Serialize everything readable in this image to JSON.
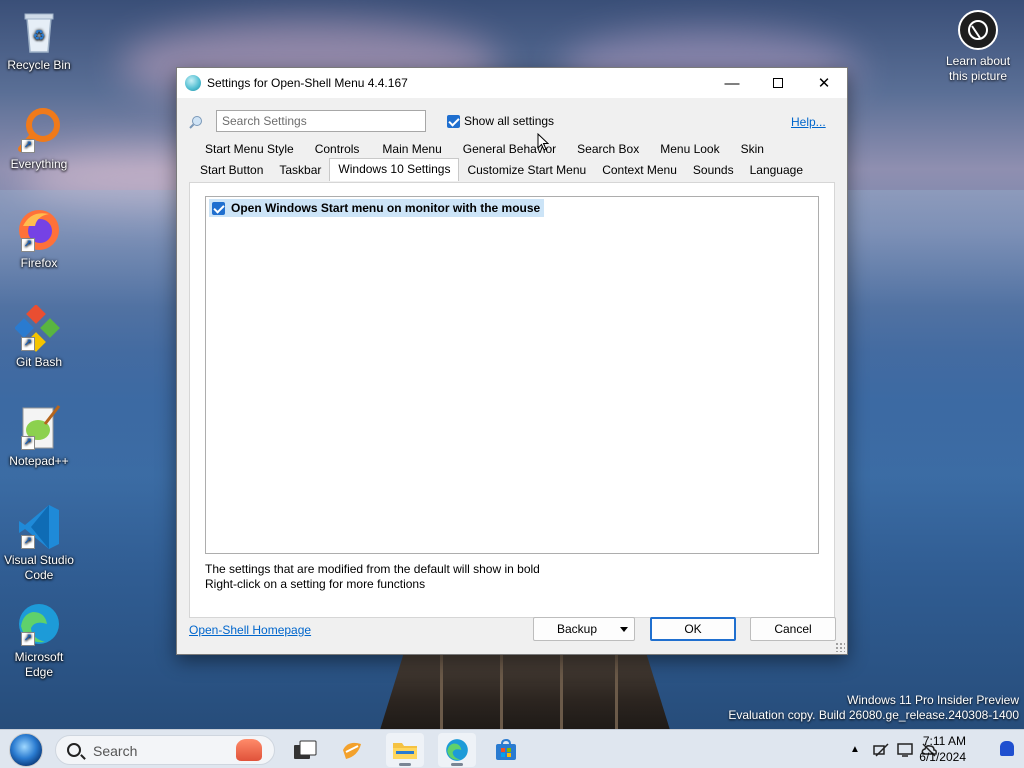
{
  "desktop": {
    "icons": [
      {
        "label": "Recycle Bin",
        "icon": "recycle-bin-icon"
      },
      {
        "label": "Everything",
        "icon": "everything-search-icon"
      },
      {
        "label": "Firefox",
        "icon": "firefox-icon"
      },
      {
        "label": "Git Bash",
        "icon": "git-bash-icon"
      },
      {
        "label": "Notepad++",
        "icon": "notepadpp-icon"
      },
      {
        "label": "Visual Studio Code",
        "icon": "vscode-icon"
      },
      {
        "label": "Microsoft Edge",
        "icon": "edge-icon"
      }
    ],
    "learn_line1": "Learn about",
    "learn_line2": "this picture",
    "watermark_line1": "Windows 11 Pro Insider Preview",
    "watermark_line2": "Evaluation copy. Build 26080.ge_release.240308-1400"
  },
  "dialog": {
    "title": "Settings for Open-Shell Menu 4.4.167",
    "search_placeholder": "Search Settings",
    "show_all_label": "Show all settings",
    "show_all_checked": true,
    "help_label": "Help...",
    "tabs_row1": [
      "Start Menu Style",
      "Controls",
      "Main Menu",
      "General Behavior",
      "Search Box",
      "Menu Look",
      "Skin"
    ],
    "tabs_row2": [
      "Start Button",
      "Taskbar",
      "Windows 10 Settings",
      "Customize Start Menu",
      "Context Menu",
      "Sounds",
      "Language"
    ],
    "active_tab": "Windows 10 Settings",
    "settings": [
      {
        "label": "Open Windows Start menu on monitor with the mouse",
        "checked": true
      }
    ],
    "hint1": "The settings that are modified from the default will show in bold",
    "hint2": "Right-click on a setting for more functions",
    "homepage_label": "Open-Shell Homepage",
    "backup_label": "Backup",
    "ok_label": "OK",
    "cancel_label": "Cancel"
  },
  "taskbar": {
    "search_label": "Search",
    "time": "7:11 AM",
    "date": "6/1/2024",
    "apps": [
      "task-view-icon",
      "widgets-icon",
      "file-explorer-icon",
      "edge-icon",
      "store-icon"
    ]
  },
  "colors": {
    "accent": "#1f6fcf",
    "link": "#0066cc",
    "selected_row": "#cce4f7"
  }
}
